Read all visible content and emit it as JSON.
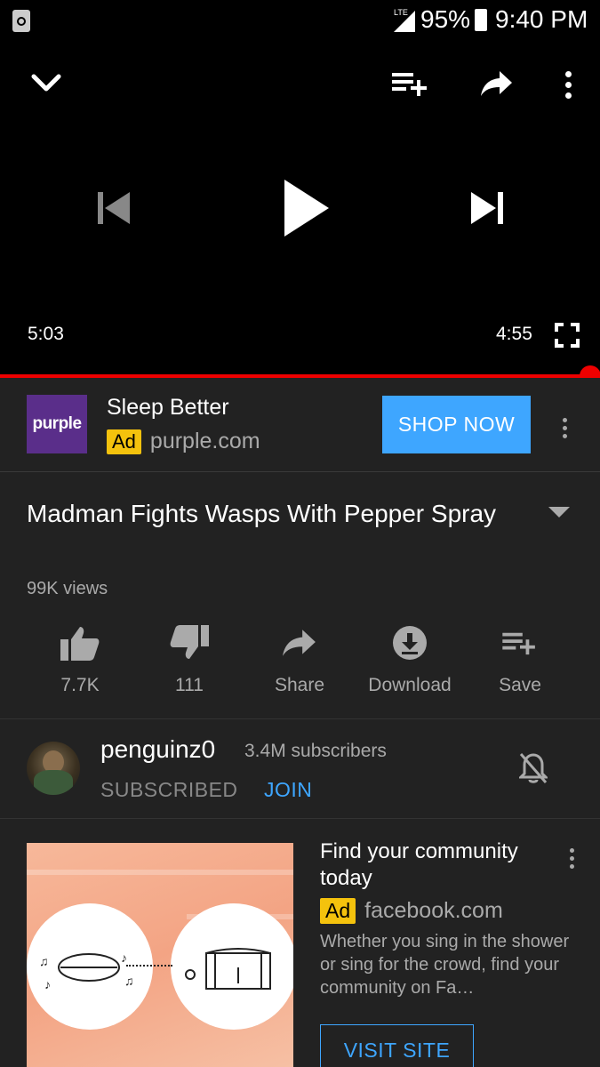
{
  "status_bar": {
    "network": "LTE",
    "battery": "95%",
    "time": "9:40 PM"
  },
  "player": {
    "elapsed": "5:03",
    "duration": "4:55",
    "progress": 1.0,
    "progress_color": "#ee0000"
  },
  "ad1": {
    "logo_text": "purple",
    "title": "Sleep Better",
    "badge": "Ad",
    "domain": "purple.com",
    "cta": "SHOP NOW",
    "cta_color": "#3ea6ff"
  },
  "video": {
    "title": "Madman Fights Wasps With Pepper Spray",
    "views": "99K views"
  },
  "actions": [
    {
      "icon": "thumbs-up-icon",
      "label": "7.7K"
    },
    {
      "icon": "thumbs-down-icon",
      "label": "111"
    },
    {
      "icon": "share-icon",
      "label": "Share"
    },
    {
      "icon": "download-icon",
      "label": "Download"
    },
    {
      "icon": "save-playlist-icon",
      "label": "Save"
    }
  ],
  "channel": {
    "name": "penguinz0",
    "subscribers": "3.4M subscribers",
    "subscribed_label": "SUBSCRIBED",
    "join_label": "JOIN"
  },
  "ad2": {
    "title": "Find your community today",
    "badge": "Ad",
    "domain": "facebook.com",
    "description": "Whether you sing in the shower or sing for the crowd, find your community on Fa…",
    "cta": "VISIT SITE"
  }
}
